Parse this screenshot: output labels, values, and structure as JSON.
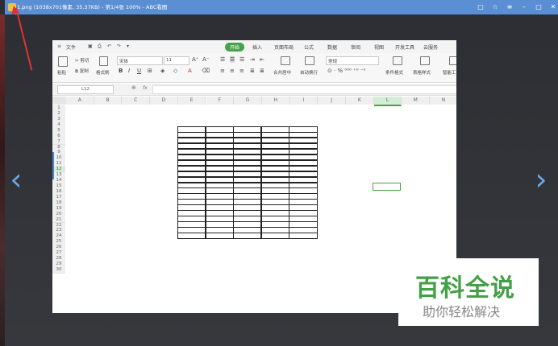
{
  "window": {
    "title": "1.png (1038x701像素, 35.37KB) - 第1/4张 100% - ABC看图",
    "controls": [
      "□",
      "☆",
      "≡",
      "–",
      "□",
      "✕"
    ]
  },
  "nav": {
    "prev": "‹",
    "next": "›"
  },
  "spreadsheet": {
    "quick_access": {
      "file": "文件"
    },
    "tabs": [
      "开始",
      "插入",
      "页面布局",
      "公式",
      "数据",
      "审阅",
      "视图",
      "开发工具",
      "云服务"
    ],
    "active_tab": "开始",
    "ribbon": {
      "paste": "粘贴",
      "cut": "剪切",
      "copy": "复制",
      "format_painter": "格式刷",
      "font_name": "宋体",
      "font_size": "11",
      "merge_center": "合并居中",
      "auto_wrap": "自动换行",
      "number_format": "常规",
      "conditional_format": "条件格式",
      "table_style": "表格样式",
      "smart": "智能工"
    },
    "name_box": "L12",
    "fx_label": "fx",
    "columns": [
      "A",
      "B",
      "C",
      "D",
      "E",
      "F",
      "G",
      "H",
      "I",
      "J",
      "K",
      "L",
      "M",
      "N"
    ],
    "selected_column": "L",
    "rows": [
      "1",
      "2",
      "3",
      "4",
      "5",
      "6",
      "7",
      "8",
      "9",
      "10",
      "11",
      "12",
      "13",
      "14",
      "15",
      "16",
      "17",
      "18",
      "19",
      "20",
      "21",
      "22",
      "23",
      "24",
      "25",
      "26",
      "27",
      "28",
      "29",
      "30"
    ],
    "selected_row": "12"
  },
  "watermark": {
    "title": "百科全说",
    "subtitle": "助你轻松解决"
  }
}
